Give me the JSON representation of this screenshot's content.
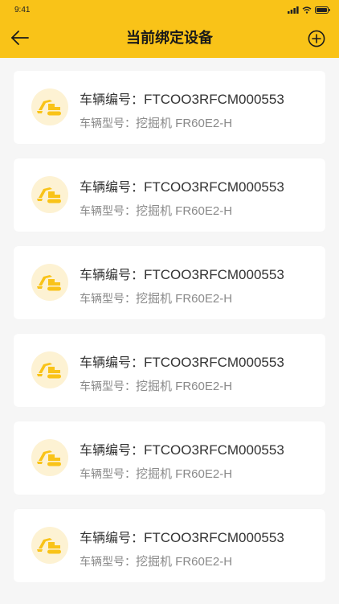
{
  "status_bar": {
    "time": "9:41",
    "icons": [
      "signal-icon",
      "wifi-icon",
      "battery-icon"
    ]
  },
  "header": {
    "title": "当前绑定设备",
    "back_icon": "arrow-left-icon",
    "add_icon": "plus-circle-icon",
    "background": "#f9c318"
  },
  "devices": [
    {
      "icon": "excavator-icon",
      "number_label": "车辆编号：",
      "number_value": "FTCOO3RFCM000553",
      "model_label": "车辆型号：",
      "model_value": "挖掘机 FR60E2-H"
    },
    {
      "icon": "excavator-icon",
      "number_label": "车辆编号：",
      "number_value": "FTCOO3RFCM000553",
      "model_label": "车辆型号：",
      "model_value": "挖掘机 FR60E2-H"
    },
    {
      "icon": "excavator-icon",
      "number_label": "车辆编号：",
      "number_value": "FTCOO3RFCM000553",
      "model_label": "车辆型号：",
      "model_value": "挖掘机 FR60E2-H"
    },
    {
      "icon": "excavator-icon",
      "number_label": "车辆编号：",
      "number_value": "FTCOO3RFCM000553",
      "model_label": "车辆型号：",
      "model_value": "挖掘机 FR60E2-H"
    },
    {
      "icon": "excavator-icon",
      "number_label": "车辆编号：",
      "number_value": "FTCOO3RFCM000553",
      "model_label": "车辆型号：",
      "model_value": "挖掘机 FR60E2-H"
    },
    {
      "icon": "excavator-icon",
      "number_label": "车辆编号：",
      "number_value": "FTCOO3RFCM000553",
      "model_label": "车辆型号：",
      "model_value": "挖掘机 FR60E2-H"
    }
  ]
}
